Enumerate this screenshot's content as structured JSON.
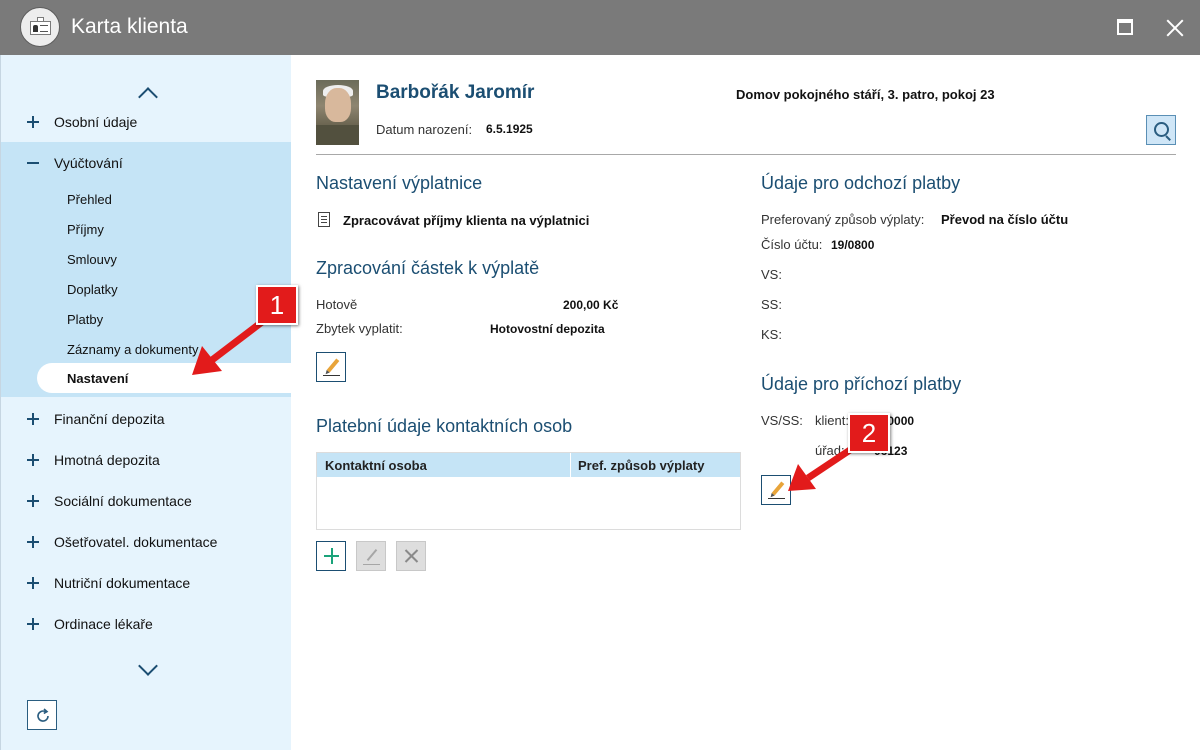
{
  "window": {
    "title": "Karta klienta"
  },
  "sidebar": {
    "sections": [
      {
        "label": "Osobní údaje",
        "expanded": false
      },
      {
        "label": "Vyúčtování",
        "expanded": true
      },
      {
        "label": "Finanční depozita",
        "expanded": false
      },
      {
        "label": "Hmotná depozita",
        "expanded": false
      },
      {
        "label": "Sociální dokumentace",
        "expanded": false
      },
      {
        "label": "Ošetřovatel. dokumentace",
        "expanded": false
      },
      {
        "label": "Nutriční dokumentace",
        "expanded": false
      },
      {
        "label": "Ordinace lékaře",
        "expanded": false
      }
    ],
    "subitems": [
      "Přehled",
      "Příjmy",
      "Smlouvy",
      "Doplatky",
      "Platby",
      "Záznamy a dokumenty",
      "Nastavení"
    ],
    "active_subitem": "Nastavení"
  },
  "client": {
    "name": "Barbořák Jaromír",
    "dob_label": "Datum narození:",
    "dob": "6.5.1925",
    "location": "Domov pokojného stáří, 3. patro, pokoj 23"
  },
  "payout": {
    "title": "Nastavení výplatnice",
    "option": "Zpracovávat příjmy klienta na výplatnici"
  },
  "processing": {
    "title": "Zpracování částek k výplatě",
    "rows": [
      {
        "label": "Hotově",
        "value": "200,00 Kč"
      },
      {
        "label": "Zbytek vyplatit:",
        "value": "Hotovostní depozita"
      }
    ]
  },
  "contacts": {
    "title": "Platební údaje kontaktních osob",
    "columns": [
      "Kontaktní osoba",
      "Pref. způsob výplaty"
    ]
  },
  "outgoing": {
    "title": "Údaje pro odchozí platby",
    "method_label": "Preferovaný způsob výplaty:",
    "method_value": "Převod na číslo účtu",
    "account_label": "Číslo účtu:",
    "account_value": "19/0800",
    "vs_label": "VS:",
    "ss_label": "SS:",
    "ks_label": "KS:"
  },
  "incoming": {
    "title": "Údaje pro příchozí platby",
    "vsss_label": "VS/SS:",
    "client_label": "klient:",
    "client_value": "150000",
    "office_label": "úřad:",
    "office_value": "06123"
  },
  "callouts": [
    "1",
    "2"
  ],
  "colors": {
    "titlebar": "#7a7a7a",
    "sidebar": "#e6f4fd",
    "sidebar_expanded": "#c5e4f6",
    "accent": "#1b4e72",
    "callout": "#e21b1b"
  }
}
